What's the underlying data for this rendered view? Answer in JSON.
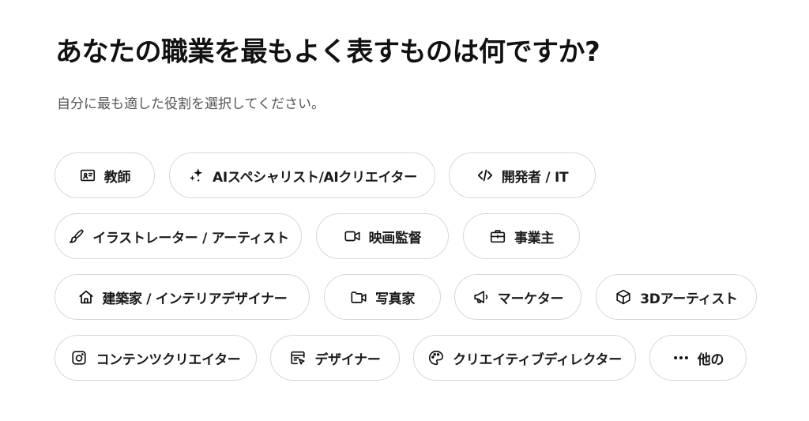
{
  "page": {
    "title": "あなたの職業を最もよく表すものは何ですか?",
    "subtitle": "自分に最も適した役割を選択してください。"
  },
  "roles": [
    {
      "label": "教師",
      "icon": "classroom-board-icon"
    },
    {
      "label": "AIスペシャリスト/AIクリエイター",
      "icon": "sparkles-icon"
    },
    {
      "label": "開発者 / IT",
      "icon": "code-icon"
    },
    {
      "label": "イラストレーター / アーティスト",
      "icon": "brush-icon"
    },
    {
      "label": "映画監督",
      "icon": "video-camera-icon"
    },
    {
      "label": "事業主",
      "icon": "briefcase-icon"
    },
    {
      "label": "建築家 / インテリアデザイナー",
      "icon": "home-icon"
    },
    {
      "label": "写真家",
      "icon": "camera-folder-icon"
    },
    {
      "label": "マーケター",
      "icon": "megaphone-icon"
    },
    {
      "label": "3Dアーティスト",
      "icon": "cube-icon"
    },
    {
      "label": "コンテンツクリエイター",
      "icon": "camera-icon"
    },
    {
      "label": "デザイナー",
      "icon": "design-window-icon"
    },
    {
      "label": "クリエイティブディレクター",
      "icon": "palette-icon"
    },
    {
      "label": "他の",
      "icon": "more-dots-icon"
    }
  ],
  "colors": {
    "text": "#111111",
    "subtext": "#555555",
    "chip_border": "#d8d8d8",
    "background": "#ffffff"
  }
}
